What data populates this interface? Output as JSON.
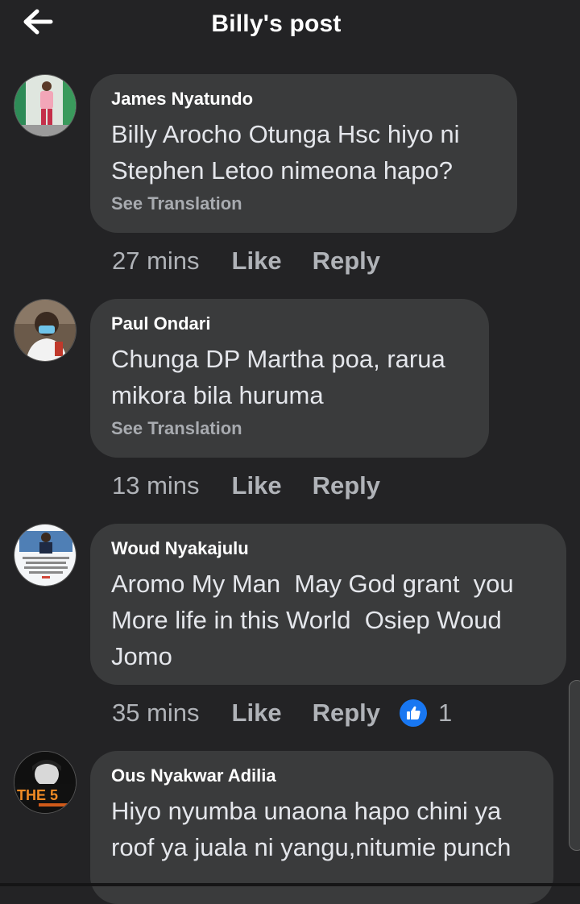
{
  "header": {
    "title": "Billy's post",
    "back_icon": "arrow-left-icon"
  },
  "comments": [
    {
      "author": "James Nyatundo",
      "text": "Billy Arocho Otunga Hsc  hiyo ni Stephen Letoo nimeona hapo?",
      "see_translation": "See Translation",
      "time": "27 mins",
      "like": "Like",
      "reply": "Reply"
    },
    {
      "author": "Paul Ondari",
      "text": "Chunga DP Martha poa, rarua mikora bila huruma",
      "see_translation": "See Translation",
      "time": "13 mins",
      "like": "Like",
      "reply": "Reply"
    },
    {
      "author": "Woud Nyakajulu",
      "text": "Aromo My Man  May God grant  you  More life in this World  Osiep Woud Jomo",
      "time": "35 mins",
      "like": "Like",
      "reply": "Reply",
      "reaction_count": "1",
      "reaction_icon": "thumbs-up-icon"
    },
    {
      "author": "Ous Nyakwar Adilia",
      "text": "Hiyo nyumba unaona hapo chini ya roof ya juala ni yangu,nitumie punch",
      "avatar_text": "THE 5"
    }
  ]
}
